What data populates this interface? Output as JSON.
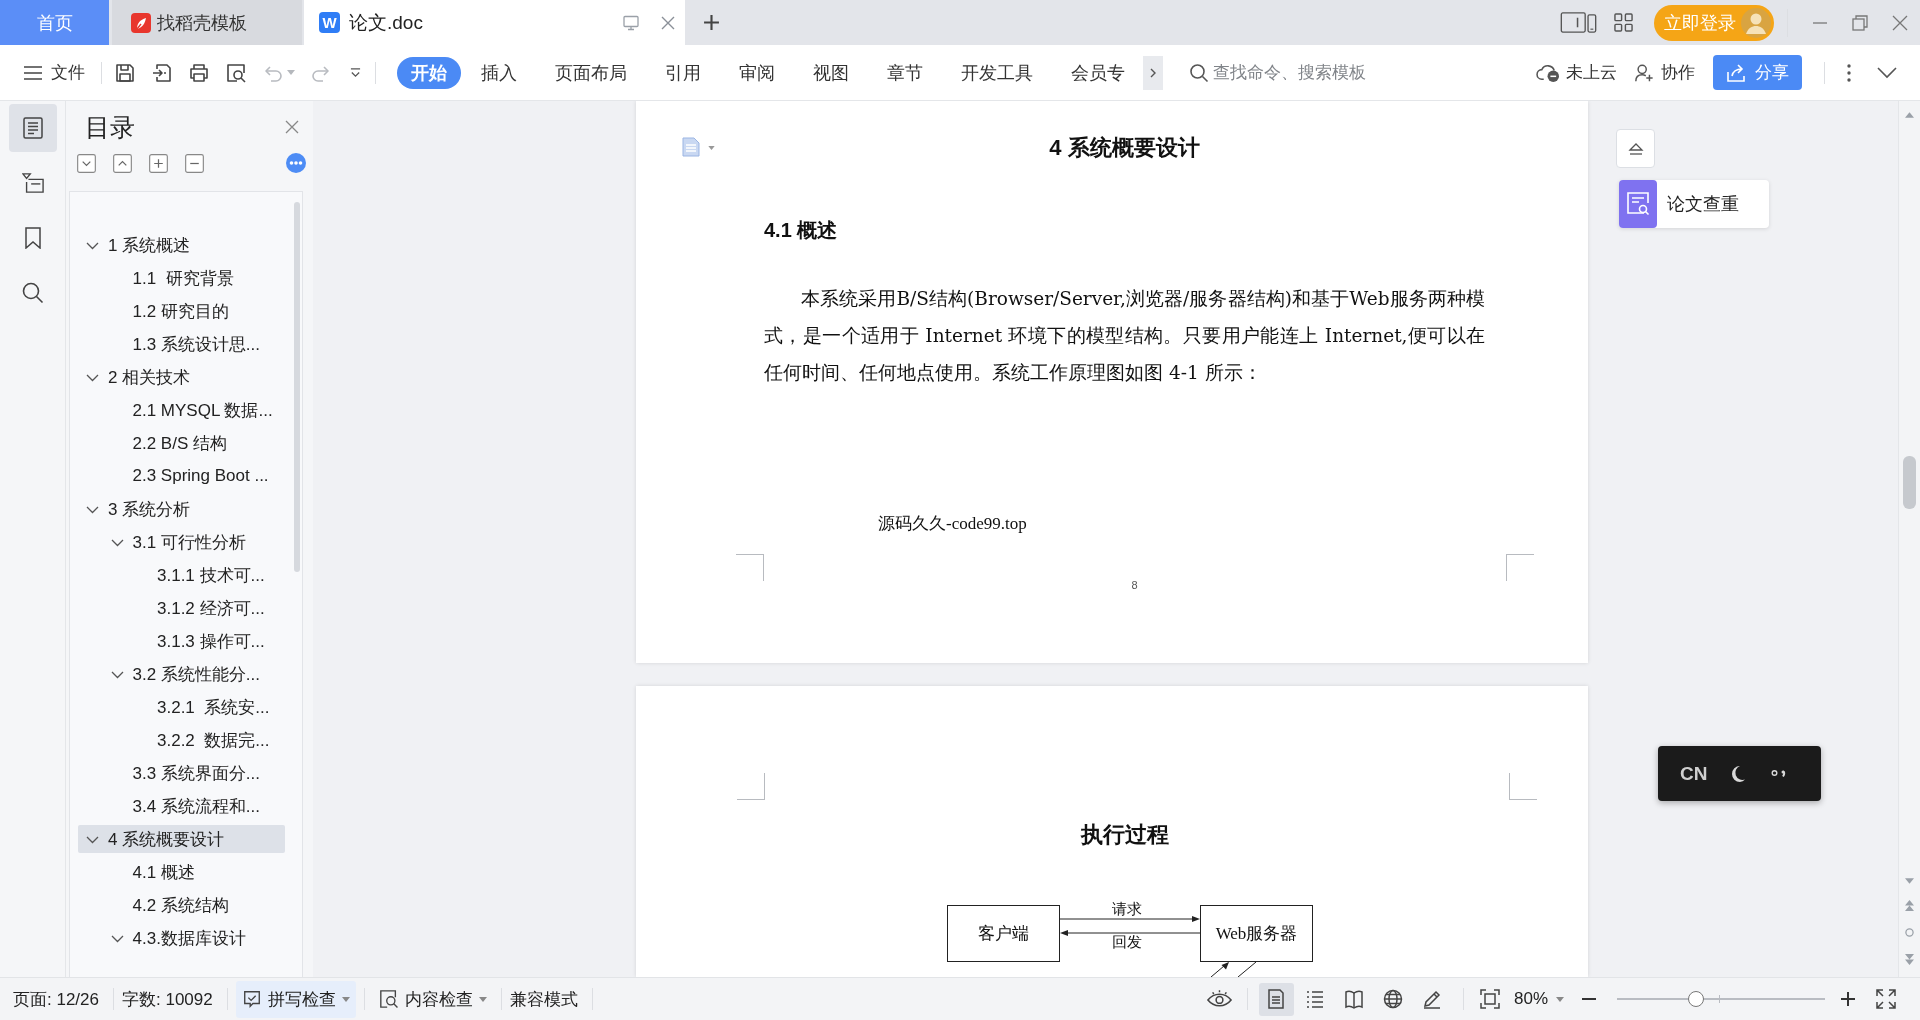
{
  "tabs": [
    {
      "kind": "home",
      "label": "首页",
      "selected": false
    },
    {
      "kind": "template",
      "label": "找稻壳模板",
      "selected": false
    },
    {
      "kind": "document",
      "badge": "W",
      "label": "论文.doc",
      "selected": true
    }
  ],
  "account": {
    "login_button": "立即登录"
  },
  "toolbar": {
    "file_menu": "文件",
    "quick_actions": [
      {
        "kind": "save",
        "disabled": false
      },
      {
        "kind": "export",
        "disabled": false
      },
      {
        "kind": "print",
        "disabled": false
      },
      {
        "kind": "preview",
        "disabled": false
      },
      {
        "kind": "undo",
        "disabled": true
      },
      {
        "kind": "redo",
        "disabled": true
      }
    ],
    "ribbon_tabs": [
      {
        "label": "开始",
        "selected": true
      },
      {
        "label": "插入",
        "selected": false
      },
      {
        "label": "页面布局",
        "selected": false
      },
      {
        "label": "引用",
        "selected": false
      },
      {
        "label": "审阅",
        "selected": false
      },
      {
        "label": "视图",
        "selected": false
      },
      {
        "label": "章节",
        "selected": false
      },
      {
        "label": "开发工具",
        "selected": false
      },
      {
        "label": "会员专",
        "selected": false
      }
    ],
    "search": {
      "placeholder": "查找命令、搜索模板"
    },
    "cloud_status": "未上云",
    "collaborate_button": "协作",
    "share_button": "分享"
  },
  "sidebar": {
    "panels": [
      {
        "kind": "toc",
        "selected": true
      },
      {
        "kind": "navigation",
        "selected": false
      },
      {
        "kind": "bookmark",
        "selected": false
      },
      {
        "kind": "search",
        "selected": false
      }
    ],
    "title": "目录",
    "toc": [
      {
        "label": "1 系统概述",
        "expanded": true,
        "selected": false,
        "children": [
          {
            "label": "1.1  研究背景",
            "selected": false
          },
          {
            "label": "1.2 研究目的",
            "selected": false
          },
          {
            "label": "1.3 系统设计思...",
            "selected": false
          }
        ]
      },
      {
        "label": "2 相关技术",
        "expanded": true,
        "selected": false,
        "children": [
          {
            "label": "2.1 MYSQL 数据...",
            "selected": false
          },
          {
            "label": "2.2 B/S 结构",
            "selected": false
          },
          {
            "label": "2.3 Spring Boot ...",
            "selected": false
          }
        ]
      },
      {
        "label": "3 系统分析",
        "expanded": true,
        "selected": false,
        "children": [
          {
            "label": "3.1 可行性分析",
            "expanded": true,
            "selected": false,
            "children": [
              {
                "label": "3.1.1 技术可...",
                "selected": false
              },
              {
                "label": "3.1.2 经济可...",
                "selected": false
              },
              {
                "label": "3.1.3 操作可...",
                "selected": false
              }
            ]
          },
          {
            "label": "3.2 系统性能分...",
            "expanded": true,
            "selected": false,
            "children": [
              {
                "label": "3.2.1  系统安...",
                "selected": false
              },
              {
                "label": "3.2.2  数据完...",
                "selected": false
              }
            ]
          },
          {
            "label": "3.3 系统界面分...",
            "selected": false
          },
          {
            "label": "3.4 系统流程和...",
            "selected": false
          }
        ]
      },
      {
        "label": "4 系统概要设计",
        "expanded": true,
        "selected": true,
        "children": [
          {
            "label": "4.1 概述",
            "selected": false
          },
          {
            "label": "4.2 系统结构",
            "selected": false
          },
          {
            "label": "4.3.数据库设计",
            "expanded": true,
            "selected": false
          }
        ]
      }
    ]
  },
  "document": {
    "page_1": {
      "chapter_title": "4 系统概要设计",
      "section_title": "4.1 概述",
      "paragraph": "本系统采用B/S结构(Browser/Server,浏览器/服务器结构)和基于Web服务两种模式，是一个适用于 Internet 环境下的模型结构。只要用户能连上 Internet,便可以在任何时间、任何地点使用。系统工作原理图如图 4-1 所示：",
      "source_note": "源码久久-code99.top",
      "page_number": "8"
    },
    "page_2": {
      "figure_title": "执行过程",
      "diagram": {
        "nodes": [
          {
            "label": "客户端"
          },
          {
            "label": "Web服务器"
          }
        ],
        "edges": [
          {
            "label": "请求",
            "kind": "rightward"
          },
          {
            "label": "回发",
            "kind": "leftward"
          }
        ]
      }
    }
  },
  "side_panel": {
    "plagiarism_check": "论文查重"
  },
  "input_method": {
    "language": "CN"
  },
  "status_bar": {
    "page": "页面: 12/26",
    "word_count": "字数: 10092",
    "checks": [
      {
        "kind": "spell",
        "label": "拼写检查",
        "highlighted": true
      },
      {
        "kind": "content",
        "label": "内容检查",
        "highlighted": false
      }
    ],
    "compat_mode": "兼容模式",
    "view_modes": [
      {
        "kind": "page",
        "selected": true
      },
      {
        "kind": "outline",
        "selected": false
      },
      {
        "kind": "reading",
        "selected": false
      },
      {
        "kind": "web",
        "selected": false
      },
      {
        "kind": "pen",
        "selected": false
      }
    ],
    "zoom": "80%",
    "zoom_slider": {
      "level": 0.38
    }
  }
}
